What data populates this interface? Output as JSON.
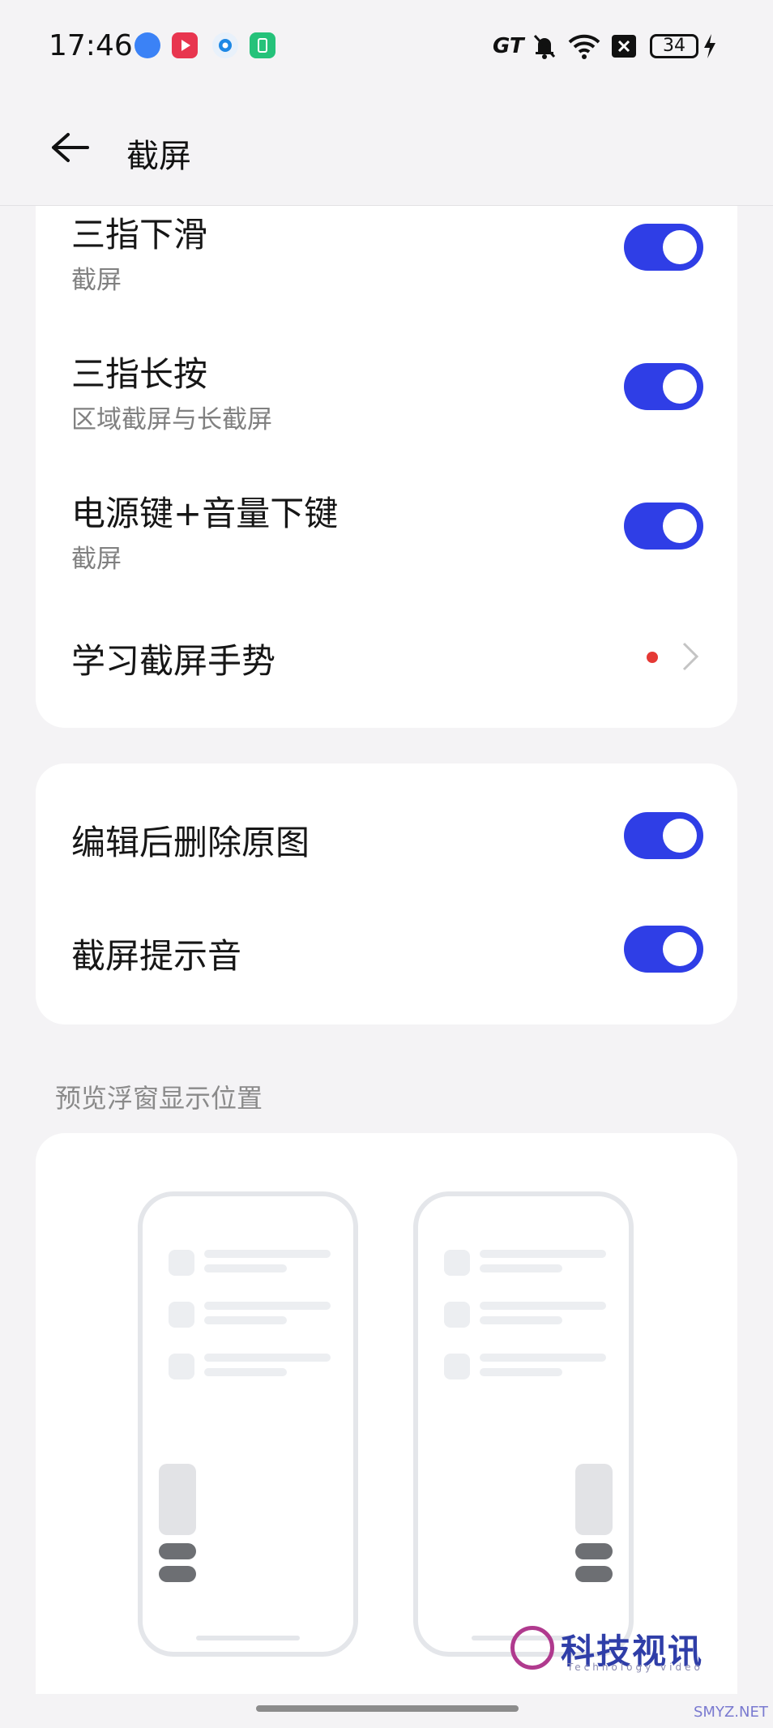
{
  "status_bar": {
    "time": "17:46",
    "app_icons": [
      "gt-app-icon",
      "video-app-icon",
      "circle-app-icon",
      "battery-app-icon"
    ],
    "network_label": "GT",
    "battery_level": "34"
  },
  "header": {
    "title": "截屏"
  },
  "gesture_card": {
    "items": [
      {
        "title": "三指下滑",
        "subtitle": "截屏",
        "enabled": true
      },
      {
        "title": "三指长按",
        "subtitle": "区域截屏与长截屏",
        "enabled": true
      },
      {
        "title": "电源键+音量下键",
        "subtitle": "截屏",
        "enabled": true
      }
    ],
    "learn_label": "学习截屏手势"
  },
  "options_card": {
    "items": [
      {
        "title": "编辑后删除原图",
        "enabled": true
      },
      {
        "title": "截屏提示音",
        "enabled": true
      }
    ]
  },
  "preview_section": {
    "label": "预览浮窗显示位置"
  },
  "watermark": {
    "brand": "科技视讯",
    "tagline": "Technology video",
    "site": "SMYZ.NET"
  },
  "colors": {
    "accent": "#2f3ee6",
    "background": "#f4f3f5",
    "card": "#ffffff",
    "dot": "#e53935"
  }
}
